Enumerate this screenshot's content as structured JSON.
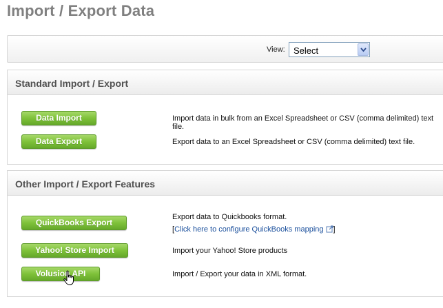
{
  "page": {
    "title": "Import / Export Data"
  },
  "view": {
    "label": "View:",
    "selected": "Select"
  },
  "sections": [
    {
      "title": "Standard Import / Export",
      "rows": [
        {
          "button": "Data Import",
          "description": "Import data in bulk from an Excel Spreadsheet or CSV (comma delimited) text file."
        },
        {
          "button": "Data Export",
          "description": "Export data to an Excel Spreadsheet or CSV (comma delimited) text file."
        }
      ]
    },
    {
      "title": "Other Import / Export Features",
      "rows": [
        {
          "button": "QuickBooks Export",
          "description": "Export data to Quickbooks format.",
          "link_prefix": "[",
          "link_text": "Click here to configure QuickBooks mapping",
          "link_suffix": "]"
        },
        {
          "button": "Yahoo! Store Import",
          "description": "Import your Yahoo! Store products"
        },
        {
          "button": "Volusion API",
          "description": "Import / Export your data in XML format."
        }
      ]
    }
  ],
  "colors": {
    "button_green": "#7fc23a",
    "link_blue": "#1a4f9c",
    "title_gray": "#808080"
  },
  "icons": {
    "select_arrow": "chevron-down-icon",
    "external_link": "external-link-icon",
    "cursor": "hand-pointer-icon"
  }
}
